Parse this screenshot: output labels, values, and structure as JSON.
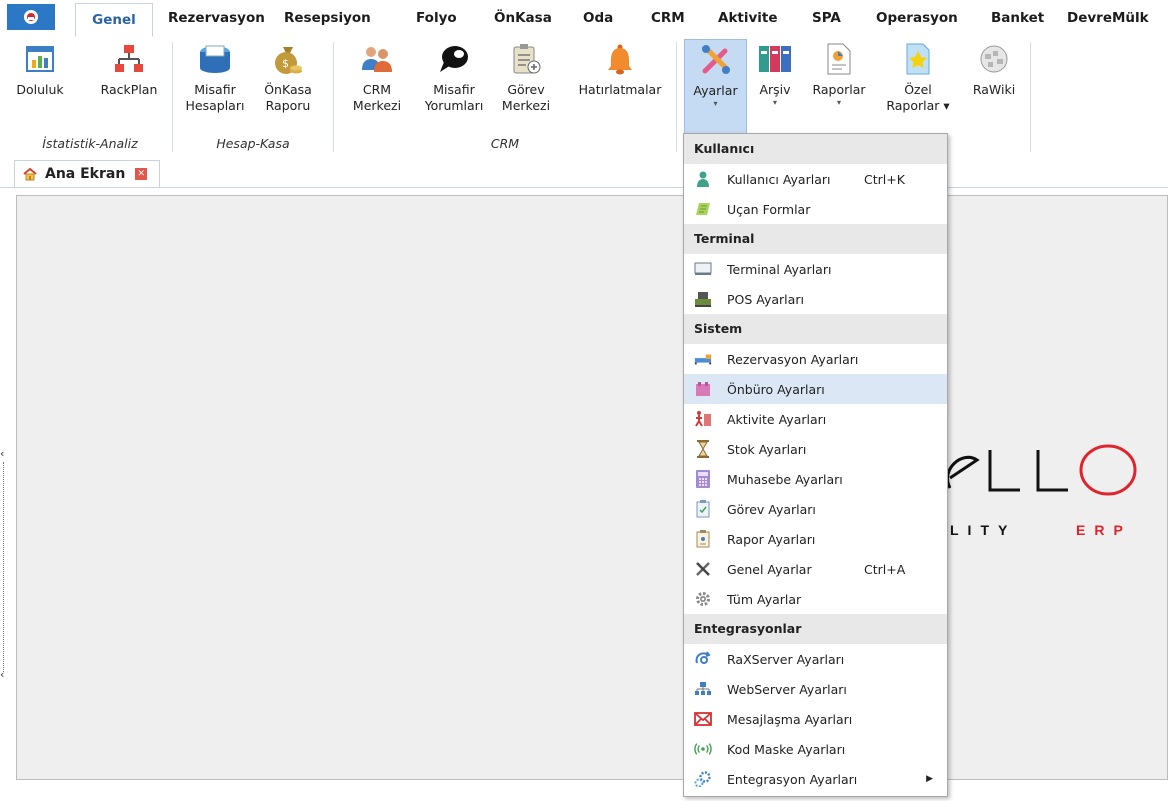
{
  "tabs": [
    {
      "label": "Genel",
      "active": true
    },
    {
      "label": "Rezervasyon"
    },
    {
      "label": "Resepsiyon"
    },
    {
      "label": "Folyo"
    },
    {
      "label": "ÖnKasa"
    },
    {
      "label": "Oda"
    },
    {
      "label": "CRM"
    },
    {
      "label": "Aktivite"
    },
    {
      "label": "SPA"
    },
    {
      "label": "Operasyon"
    },
    {
      "label": "Banket"
    },
    {
      "label": "DevreMülk"
    }
  ],
  "ribbon": {
    "buttons": [
      {
        "line1": "Doluluk",
        "line2": "",
        "icon": "occupancy-chart-icon"
      },
      {
        "line1": "RackPlan",
        "line2": "",
        "icon": "rack-plan-icon"
      },
      {
        "line1": "Misafir",
        "line2": "Hesapları",
        "icon": "guest-accounts-icon"
      },
      {
        "line1": "ÖnKasa",
        "line2": "Raporu",
        "icon": "money-bag-icon"
      },
      {
        "line1": "CRM",
        "line2": "Merkezi",
        "icon": "crm-people-icon"
      },
      {
        "line1": "Misafir",
        "line2": "Yorumları",
        "icon": "speech-bubble-icon"
      },
      {
        "line1": "Görev",
        "line2": "Merkezi",
        "icon": "task-clipboard-icon"
      },
      {
        "line1": "Hatırlatmalar",
        "line2": "",
        "icon": "bell-icon"
      },
      {
        "line1": "Ayarlar",
        "line2": "▾",
        "icon": "settings-tools-icon"
      },
      {
        "line1": "Arşiv",
        "line2": "▾",
        "icon": "archive-binders-icon"
      },
      {
        "line1": "Raporlar",
        "line2": "▾",
        "icon": "report-document-icon"
      },
      {
        "line1": "Özel",
        "line2": "Raporlar ▾",
        "icon": "star-report-icon"
      },
      {
        "line1": "RaWiki",
        "line2": "",
        "icon": "wiki-globe-icon"
      }
    ],
    "groups": [
      "İstatistik-Analiz",
      "Hesap-Kasa",
      "CRM"
    ]
  },
  "document_tab": {
    "label": "Ana Ekran"
  },
  "logo": {
    "letters": "eLLO",
    "tagline_left": "LITY",
    "tagline_right": "ERP",
    "accent": "#e0242b"
  },
  "menu": {
    "sections": [
      {
        "header": "Kullanıcı",
        "items": [
          {
            "label": "Kullanıcı Ayarları",
            "shortcut": "Ctrl+K",
            "icon": "user-icon"
          },
          {
            "label": "Uçan Formlar",
            "shortcut": "",
            "icon": "flying-form-icon"
          }
        ]
      },
      {
        "header": "Terminal",
        "items": [
          {
            "label": "Terminal Ayarları",
            "shortcut": "",
            "icon": "monitor-icon"
          },
          {
            "label": "POS Ayarları",
            "shortcut": "",
            "icon": "pos-terminal-icon"
          }
        ]
      },
      {
        "header": "Sistem",
        "items": [
          {
            "label": "Rezervasyon Ayarları",
            "shortcut": "",
            "icon": "bed-icon"
          },
          {
            "label": "Önbüro Ayarları",
            "shortcut": "",
            "icon": "front-office-icon",
            "highlighted": true
          },
          {
            "label": "Aktivite Ayarları",
            "shortcut": "",
            "icon": "activity-icon"
          },
          {
            "label": "Stok Ayarları",
            "shortcut": "",
            "icon": "hourglass-icon"
          },
          {
            "label": "Muhasebe Ayarları",
            "shortcut": "",
            "icon": "calculator-icon"
          },
          {
            "label": "Görev Ayarları",
            "shortcut": "",
            "icon": "task-list-icon"
          },
          {
            "label": "Rapor Ayarları",
            "shortcut": "",
            "icon": "report-clipboard-icon"
          },
          {
            "label": "Genel Ayarlar",
            "shortcut": "Ctrl+A",
            "icon": "tools-icon"
          },
          {
            "label": "Tüm Ayarlar",
            "shortcut": "",
            "icon": "gear-icon"
          }
        ]
      },
      {
        "header": "Entegrasyonlar",
        "items": [
          {
            "label": "RaXServer Ayarları",
            "shortcut": "",
            "icon": "sync-icon"
          },
          {
            "label": "WebServer Ayarları",
            "shortcut": "",
            "icon": "network-icon"
          },
          {
            "label": "Mesajlaşma Ayarları",
            "shortcut": "",
            "icon": "envelope-icon"
          },
          {
            "label": "Kod Maske Ayarları",
            "shortcut": "",
            "icon": "signal-icon"
          },
          {
            "label": "Entegrasyon Ayarları",
            "shortcut": "",
            "icon": "puzzle-gear-icon",
            "submenu": true
          }
        ]
      }
    ]
  }
}
